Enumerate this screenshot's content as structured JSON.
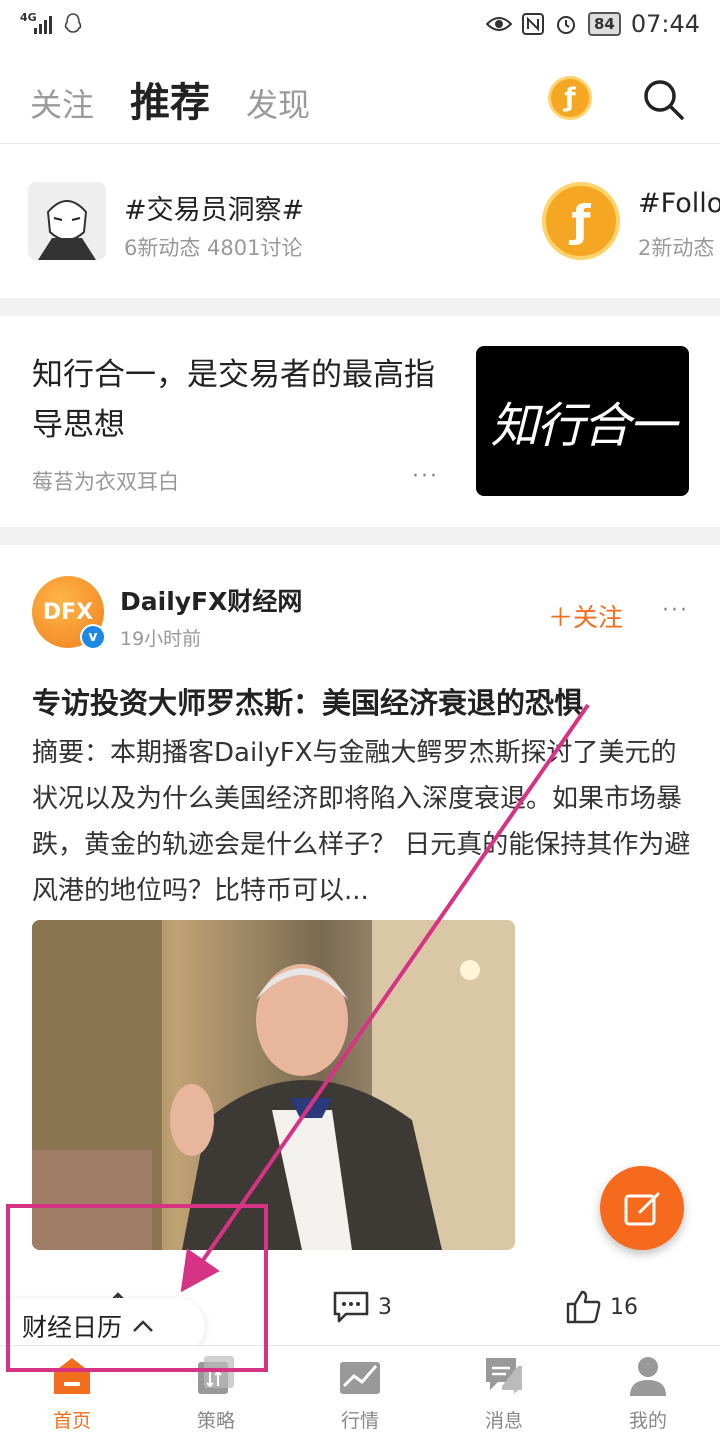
{
  "status_bar": {
    "signal": "4G",
    "battery": "84",
    "time": "07:44"
  },
  "header": {
    "tabs": [
      {
        "label": "关注"
      },
      {
        "label": "推荐"
      },
      {
        "label": "发现"
      }
    ],
    "coin_glyph": "ƒ",
    "search_icon": "search-icon"
  },
  "topics": [
    {
      "title": "#交易员洞察#",
      "sub": "6新动态 4801讨论"
    },
    {
      "title": "#Follo",
      "sub": "2新动态"
    }
  ],
  "article": {
    "title": "知行合一，是交易者的最高指导思想",
    "author": "莓苔为衣双耳白",
    "more": "···",
    "image_text": "知行合一"
  },
  "post": {
    "avatar_text": "DFX",
    "verified": "v",
    "author": "DailyFX财经网",
    "time": "19小时前",
    "follow": "＋关注",
    "more": "···",
    "title": "专访投资大师罗杰斯：美国经济衰退的恐惧",
    "summary": "摘要：本期播客DailyFX与金融大鳄罗杰斯探讨了美元的状况以及为什么美国经济即将陷入深度衰退。如果市场暴跌，黄金的轨迹会是什么样子？ 日元真的能保持其作为避风港的地位吗？比特币可以...",
    "comments": "3",
    "likes": "16"
  },
  "calendar": {
    "label": "财经日历"
  },
  "nav": [
    {
      "label": "首页",
      "icon": "home-icon"
    },
    {
      "label": "策略",
      "icon": "strategy-icon"
    },
    {
      "label": "行情",
      "icon": "market-icon"
    },
    {
      "label": "消息",
      "icon": "message-icon"
    },
    {
      "label": "我的",
      "icon": "profile-icon"
    }
  ],
  "colors": {
    "accent": "#f26e1d",
    "annotation": "#d63384"
  }
}
